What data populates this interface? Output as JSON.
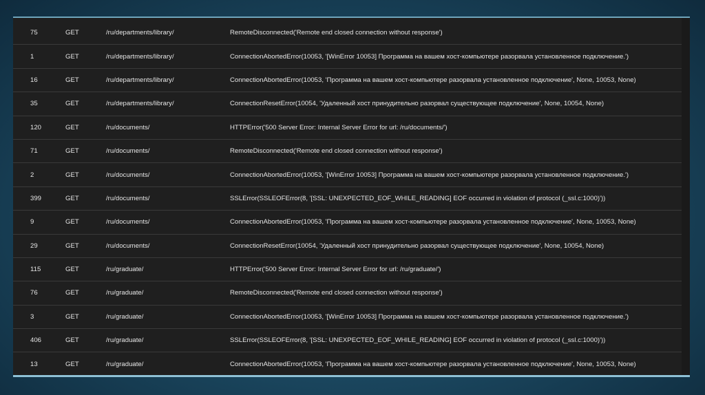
{
  "rows": [
    {
      "count": "75",
      "method": "GET",
      "url": "/ru/departments/library/",
      "error": "RemoteDisconnected('Remote end closed connection without response')"
    },
    {
      "count": "1",
      "method": "GET",
      "url": "/ru/departments/library/",
      "error": "ConnectionAbortedError(10053, '[WinError 10053] Программа на вашем хост-компьютере разорвала установленное подключение.')"
    },
    {
      "count": "16",
      "method": "GET",
      "url": "/ru/departments/library/",
      "error": "ConnectionAbortedError(10053, 'Программа на вашем хост-компьютере разорвала установленное подключение', None, 10053, None)"
    },
    {
      "count": "35",
      "method": "GET",
      "url": "/ru/departments/library/",
      "error": "ConnectionResetError(10054, 'Удаленный хост принудительно разорвал существующее подключение', None, 10054, None)"
    },
    {
      "count": "120",
      "method": "GET",
      "url": "/ru/documents/",
      "error": "HTTPError('500 Server Error: Internal Server Error for url: /ru/documents/')"
    },
    {
      "count": "71",
      "method": "GET",
      "url": "/ru/documents/",
      "error": "RemoteDisconnected('Remote end closed connection without response')"
    },
    {
      "count": "2",
      "method": "GET",
      "url": "/ru/documents/",
      "error": "ConnectionAbortedError(10053, '[WinError 10053] Программа на вашем хост-компьютере разорвала установленное подключение.')"
    },
    {
      "count": "399",
      "method": "GET",
      "url": "/ru/documents/",
      "error": "SSLError(SSLEOFError(8, '[SSL: UNEXPECTED_EOF_WHILE_READING] EOF occurred in violation of protocol (_ssl.c:1000)'))"
    },
    {
      "count": "9",
      "method": "GET",
      "url": "/ru/documents/",
      "error": "ConnectionAbortedError(10053, 'Программа на вашем хост-компьютере разорвала установленное подключение', None, 10053, None)"
    },
    {
      "count": "29",
      "method": "GET",
      "url": "/ru/documents/",
      "error": "ConnectionResetError(10054, 'Удаленный хост принудительно разорвал существующее подключение', None, 10054, None)"
    },
    {
      "count": "115",
      "method": "GET",
      "url": "/ru/graduate/",
      "error": "HTTPError('500 Server Error: Internal Server Error for url: /ru/graduate/')"
    },
    {
      "count": "76",
      "method": "GET",
      "url": "/ru/graduate/",
      "error": "RemoteDisconnected('Remote end closed connection without response')"
    },
    {
      "count": "3",
      "method": "GET",
      "url": "/ru/graduate/",
      "error": "ConnectionAbortedError(10053, '[WinError 10053] Программа на вашем хост-компьютере разорвала установленное подключение.')"
    },
    {
      "count": "406",
      "method": "GET",
      "url": "/ru/graduate/",
      "error": "SSLError(SSLEOFError(8, '[SSL: UNEXPECTED_EOF_WHILE_READING] EOF occurred in violation of protocol (_ssl.c:1000)'))"
    },
    {
      "count": "13",
      "method": "GET",
      "url": "/ru/graduate/",
      "error": "ConnectionAbortedError(10053, 'Программа на вашем хост-компьютере разорвала установленное подключение', None, 10053, None)"
    }
  ]
}
